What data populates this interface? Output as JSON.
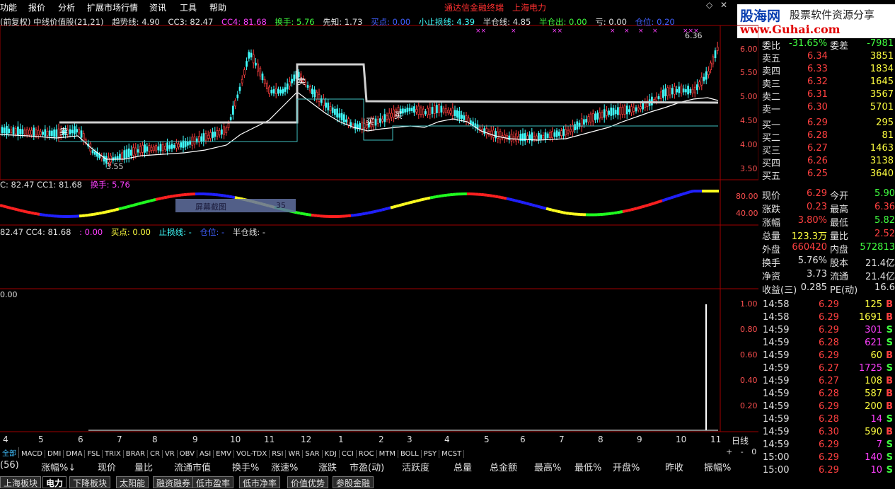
{
  "menu": [
    "功能",
    "报价",
    "分析",
    "扩展市场行情",
    "资讯",
    "工具",
    "帮助"
  ],
  "terminal_title": "通达信金融终端",
  "stock_title": "上海电力",
  "logo": {
    "main": "股海网",
    "sub": "股票软件资源分享",
    "url": "www.Guhai.com"
  },
  "main_indicator": {
    "items": [
      {
        "text": "(前复权) 中线价值股(21,21)",
        "color": "#e0e0e0"
      },
      {
        "text": "趋势线: 4.90",
        "color": "#e0e0e0"
      },
      {
        "text": "CC3: 82.47",
        "color": "#e0e0e0"
      },
      {
        "text": "CC4: 81.68",
        "color": "#ff40ff"
      },
      {
        "text": "换手: 5.76",
        "color": "#40ff40"
      },
      {
        "text": "先知: 1.73",
        "color": "#e0e0e0"
      },
      {
        "text": "买点: 0.00",
        "color": "#4060ff"
      },
      {
        "text": "小止损线: 4.39",
        "color": "#40ffff"
      },
      {
        "text": "半仓线: 4.85",
        "color": "#e0e0e0"
      },
      {
        "text": "半仓出: 0.00",
        "color": "#40ff40"
      },
      {
        "text": "亏: 0.00",
        "color": "#e0e0e0"
      },
      {
        "text": "仓位: 0.20",
        "color": "#4060ff"
      }
    ]
  },
  "price_axis": [
    "6.00",
    "5.50",
    "5.00",
    "4.50",
    "4.00",
    "3.50"
  ],
  "annotations": {
    "high": "6.36",
    "low": "3.55",
    "sell1": "卖",
    "sell2": "卖",
    "buy1": "买",
    "buy2": "买"
  },
  "sub1_indicator": {
    "items": [
      {
        "text": "C: 82.47  CC1: 81.68",
        "color": "#e0e0e0"
      },
      {
        "text": "换手: 5.76",
        "color": "#ff40ff"
      }
    ]
  },
  "sub1_axis": [
    "80.00",
    "40.00"
  ],
  "screenshot_box": {
    "label": "屏幕截图",
    "value": "35"
  },
  "sub2_indicator": {
    "items": [
      {
        "text": "82.47  CC4: 81.68",
        "color": "#e0e0e0"
      },
      {
        "text": ": 0.00",
        "color": "#ff40ff"
      },
      {
        "text": "买点: 0.00",
        "color": "#ffff40"
      },
      {
        "text": "止损线: -",
        "color": "#40ffff"
      },
      {
        "text": "仓位: -",
        "color": "#4060ff"
      },
      {
        "text": "半仓线: -",
        "color": "#e0e0e0"
      }
    ]
  },
  "sub3_value": "0.00",
  "sub3_axis": [
    "1.00",
    "0.80",
    "0.60",
    "0.40",
    "0.20"
  ],
  "month_axis": [
    "4",
    "5",
    "6",
    "7",
    "8",
    "9",
    "10",
    "11",
    "12",
    "1",
    "2",
    "3",
    "4",
    "5",
    "6",
    "7",
    "8",
    "9",
    "10",
    "11"
  ],
  "period": "日线",
  "quote": {
    "ratio": {
      "label": "委比",
      "value": "-31.65%",
      "label2": "委差",
      "value2": "-7981"
    },
    "sell": [
      {
        "label": "卖五",
        "price": "6.34",
        "vol": "3851"
      },
      {
        "label": "卖四",
        "price": "6.33",
        "vol": "1834"
      },
      {
        "label": "卖三",
        "price": "6.32",
        "vol": "1645"
      },
      {
        "label": "卖二",
        "price": "6.31",
        "vol": "3567"
      },
      {
        "label": "卖一",
        "price": "6.30",
        "vol": "5701"
      }
    ],
    "buy": [
      {
        "label": "买一",
        "price": "6.29",
        "vol": "295"
      },
      {
        "label": "买二",
        "price": "6.28",
        "vol": "81"
      },
      {
        "label": "买三",
        "price": "6.27",
        "vol": "1463"
      },
      {
        "label": "买四",
        "price": "6.26",
        "vol": "3138"
      },
      {
        "label": "买五",
        "price": "6.25",
        "vol": "3640"
      }
    ],
    "info": [
      {
        "l1": "现价",
        "v1": "6.29",
        "c1": "#ff4040",
        "l2": "今开",
        "v2": "5.90",
        "c2": "#40ff40"
      },
      {
        "l1": "涨跌",
        "v1": "0.23",
        "c1": "#ff4040",
        "l2": "最高",
        "v2": "6.36",
        "c2": "#ff4040"
      },
      {
        "l1": "涨幅",
        "v1": "3.80%",
        "c1": "#ff4040",
        "l2": "最低",
        "v2": "5.82",
        "c2": "#40ff40"
      },
      {
        "l1": "总量",
        "v1": "123.3万",
        "c1": "#ffff40",
        "l2": "量比",
        "v2": "2.52",
        "c2": "#ff4040"
      },
      {
        "l1": "外盘",
        "v1": "660420",
        "c1": "#ff4040",
        "l2": "内盘",
        "v2": "572813",
        "c2": "#40ff40"
      },
      {
        "l1": "换手",
        "v1": "5.76%",
        "c1": "#e0e0e0",
        "l2": "股本",
        "v2": "21.4亿",
        "c2": "#e0e0e0"
      },
      {
        "l1": "净资",
        "v1": "3.73",
        "c1": "#e0e0e0",
        "l2": "流通",
        "v2": "21.4亿",
        "c2": "#e0e0e0"
      },
      {
        "l1": "收益(三)",
        "v1": "0.285",
        "c1": "#e0e0e0",
        "l2": "PE(动)",
        "v2": "16.6",
        "c2": "#e0e0e0"
      }
    ]
  },
  "ticks": [
    {
      "time": "14:58",
      "price": "6.29",
      "vol": "125",
      "dir": "B"
    },
    {
      "time": "14:58",
      "price": "6.29",
      "vol": "1691",
      "dir": "B"
    },
    {
      "time": "14:59",
      "price": "6.29",
      "vol": "301",
      "dir": "S"
    },
    {
      "time": "14:59",
      "price": "6.28",
      "vol": "621",
      "dir": "S"
    },
    {
      "time": "14:59",
      "price": "6.29",
      "vol": "60",
      "dir": "B"
    },
    {
      "time": "14:59",
      "price": "6.27",
      "vol": "1725",
      "dir": "S"
    },
    {
      "time": "14:59",
      "price": "6.27",
      "vol": "108",
      "dir": "B"
    },
    {
      "time": "14:59",
      "price": "6.28",
      "vol": "587",
      "dir": "B"
    },
    {
      "time": "14:59",
      "price": "6.29",
      "vol": "200",
      "dir": "B"
    },
    {
      "time": "14:59",
      "price": "6.28",
      "vol": "14",
      "dir": "S"
    },
    {
      "time": "14:59",
      "price": "6.30",
      "vol": "590",
      "dir": "B"
    },
    {
      "time": "14:59",
      "price": "6.29",
      "vol": "7",
      "dir": "S"
    },
    {
      "time": "15:00",
      "price": "6.29",
      "vol": "140",
      "dir": "S"
    },
    {
      "time": "15:00",
      "price": "6.29",
      "vol": "10",
      "dir": "S"
    }
  ],
  "indicator_tabs": [
    "全部",
    "MACD",
    "DMI",
    "DMA",
    "FSL",
    "TRIX",
    "BRAR",
    "CR",
    "VR",
    "OBV",
    "ASI",
    "EMV",
    "VOL-TDX",
    "RSI",
    "WR",
    "SAR",
    "KDJ",
    "CCI",
    "ROC",
    "MTM",
    "BOLL",
    "PSY",
    "MCST"
  ],
  "columns": [
    "(56)",
    "涨幅%↓",
    "现价",
    "量比",
    "流通市值",
    "换手%",
    "涨速%",
    "涨跌",
    "市盈(动)",
    "活跃度",
    "总量",
    "总金额",
    "最高%",
    "最低%",
    "开盘%",
    "昨收",
    "振幅%"
  ],
  "bottom_tabs": [
    "上海板块",
    "电力",
    "下降板块",
    "太阳能",
    "融资融券",
    "低市盈率",
    "低市净率",
    "价值优势",
    "参股金融"
  ],
  "zoom_controls": [
    "+",
    "-",
    "0"
  ]
}
